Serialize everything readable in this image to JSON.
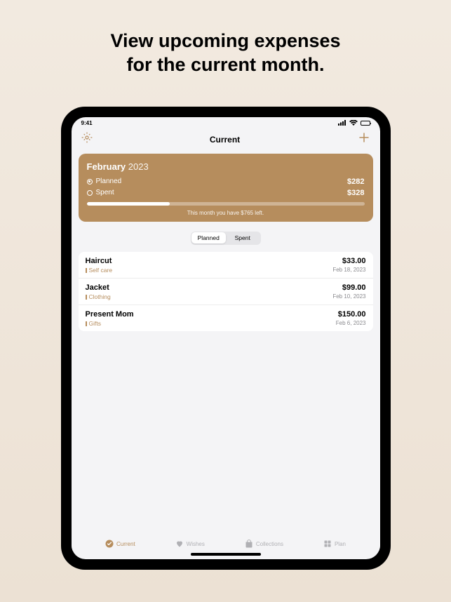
{
  "promo": {
    "line1": "View upcoming expenses",
    "line2": "for the current month."
  },
  "status": {
    "time": "9:41"
  },
  "nav": {
    "title": "Current"
  },
  "summary": {
    "month": "February",
    "year": "2023",
    "rows": [
      {
        "label": "Planned",
        "value": "$282",
        "selected": true
      },
      {
        "label": "Spent",
        "value": "$328",
        "selected": false
      }
    ],
    "progress_pct": 30,
    "footer": "This month you have $765 left."
  },
  "segment": {
    "options": [
      "Planned",
      "Spent"
    ],
    "active_index": 0
  },
  "expenses": [
    {
      "title": "Haircut",
      "category": "Self care",
      "amount": "$33.00",
      "date": "Feb 18, 2023"
    },
    {
      "title": "Jacket",
      "category": "Clothing",
      "amount": "$99.00",
      "date": "Feb 10, 2023"
    },
    {
      "title": "Present Mom",
      "category": "Gifts",
      "amount": "$150.00",
      "date": "Feb 6, 2023"
    }
  ],
  "tabs": [
    {
      "label": "Current",
      "icon": "check"
    },
    {
      "label": "Wishes",
      "icon": "heart"
    },
    {
      "label": "Collections",
      "icon": "bag"
    },
    {
      "label": "Plan",
      "icon": "grid"
    }
  ],
  "active_tab_index": 0,
  "colors": {
    "accent": "#b68d5d"
  }
}
